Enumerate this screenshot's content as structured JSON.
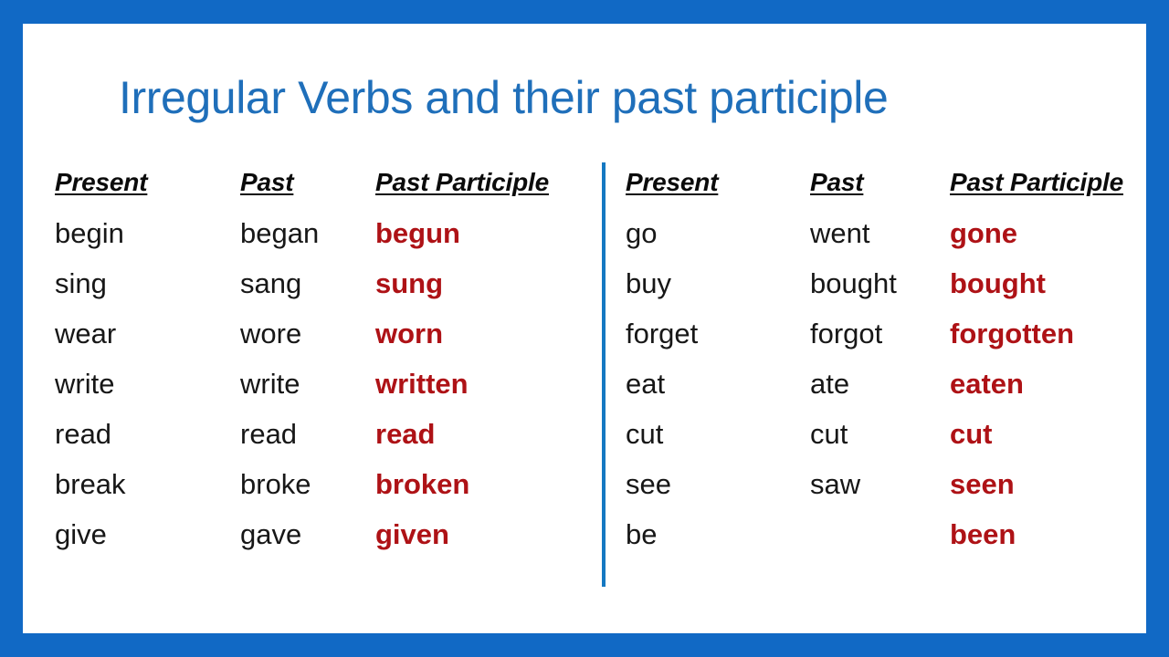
{
  "slide": {
    "title": "Irregular Verbs and their past participle",
    "colors": {
      "frame_blue": "#1169c5",
      "title_blue": "#1f6fba",
      "divider_blue": "#1478c2",
      "participle_red": "#ae1216",
      "body_black": "#171717",
      "canvas_white": "#ffffff"
    }
  },
  "tables": [
    {
      "id": "left",
      "headers": {
        "present": "Present",
        "past": "Past",
        "participle": "Past Participle"
      },
      "rows": [
        {
          "present": "begin",
          "past": "began",
          "participle": "begun"
        },
        {
          "present": "sing",
          "past": "sang",
          "participle": "sung"
        },
        {
          "present": "wear",
          "past": "wore",
          "participle": "worn"
        },
        {
          "present": "write",
          "past": "write",
          "participle": "written"
        },
        {
          "present": "read",
          "past": "read",
          "participle": "read"
        },
        {
          "present": "break",
          "past": "broke",
          "participle": "broken"
        },
        {
          "present": "give",
          "past": "gave",
          "participle": "given"
        }
      ]
    },
    {
      "id": "right",
      "headers": {
        "present": "Present",
        "past": "Past",
        "participle": "Past Participle"
      },
      "rows": [
        {
          "present": "go",
          "past": "went",
          "participle": "gone"
        },
        {
          "present": "buy",
          "past": "bought",
          "participle": "bought"
        },
        {
          "present": "forget",
          "past": "forgot",
          "participle": "forgotten"
        },
        {
          "present": "eat",
          "past": "ate",
          "participle": "eaten"
        },
        {
          "present": "cut",
          "past": "cut",
          "participle": "cut"
        },
        {
          "present": "see",
          "past": "saw",
          "participle": "seen"
        },
        {
          "present": "be",
          "past": "",
          "participle": "been"
        }
      ]
    }
  ]
}
